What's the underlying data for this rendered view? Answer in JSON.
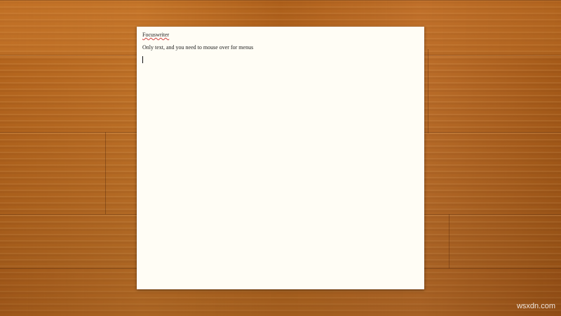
{
  "document": {
    "title": "Focuswriter",
    "body_line": "Only text, and you need to mouse over for menus"
  },
  "watermark": "wsxdn.com",
  "colors": {
    "desk": "#b5651d",
    "paper": "#fffdf5",
    "text": "#222222",
    "spellcheck_underline": "#d04040"
  }
}
